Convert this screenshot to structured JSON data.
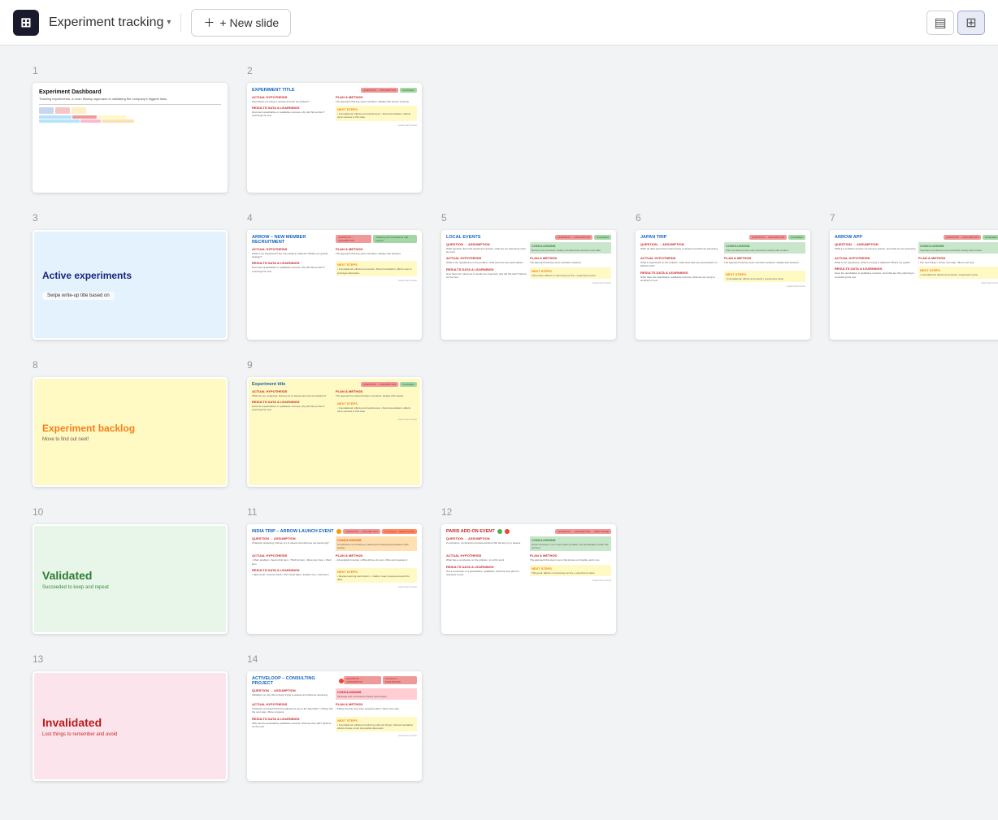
{
  "toolbar": {
    "logo_label": "⊞",
    "title": "Experiment tracking",
    "new_slide_label": "+ New slide",
    "view_single_label": "▤",
    "view_grid_label": "⊞"
  },
  "slides": [
    {
      "number": 1,
      "type": "dashboard",
      "title": "Experiment Dashboard",
      "bg": "#ffffff"
    },
    {
      "number": 2,
      "type": "template",
      "title": "EXPERIMENT TITLE",
      "bg": "#ffffff"
    },
    {
      "number": 3,
      "type": "section",
      "title": "Active experiments",
      "tag": "Swipe write-up title based on",
      "bg": "#e3f2fd"
    },
    {
      "number": 4,
      "type": "experiment",
      "title": "ARROW – NEW MEMBER RECRUITMENT",
      "bg": "#ffffff"
    },
    {
      "number": 5,
      "type": "experiment",
      "title": "LOCAL EVENTS",
      "bg": "#ffffff"
    },
    {
      "number": 6,
      "type": "experiment",
      "title": "JAPAN TRIP",
      "bg": "#ffffff"
    },
    {
      "number": 7,
      "type": "experiment",
      "title": "ARROW APP",
      "bg": "#ffffff"
    },
    {
      "number": 8,
      "type": "section",
      "title": "Experiment backlog",
      "sub": "Move to find out next!",
      "bg": "#fff9c4"
    },
    {
      "number": 9,
      "type": "template",
      "title": "Experiment title",
      "bg": "#fff9c4"
    },
    {
      "number": 10,
      "type": "section",
      "title": "Validated",
      "sub": "Succeeded to keep and repeat",
      "bg": "#e8f5e9"
    },
    {
      "number": 11,
      "type": "experiment",
      "title": "INDIA TRIP – ARROW LAUNCH EVENT",
      "bg": "#ffffff",
      "dot": "orange"
    },
    {
      "number": 12,
      "type": "experiment",
      "title": "PARIS ADD-ON EVENT",
      "bg": "#ffffff",
      "dot": "both"
    },
    {
      "number": 13,
      "type": "section",
      "title": "Invalidated",
      "sub": "Lost things to remember and avoid",
      "bg": "#fce4ec"
    },
    {
      "number": 14,
      "type": "experiment",
      "title": "ACTIVELOOP – CONSULTING PROJECT",
      "bg": "#ffffff",
      "dot": "red"
    }
  ]
}
